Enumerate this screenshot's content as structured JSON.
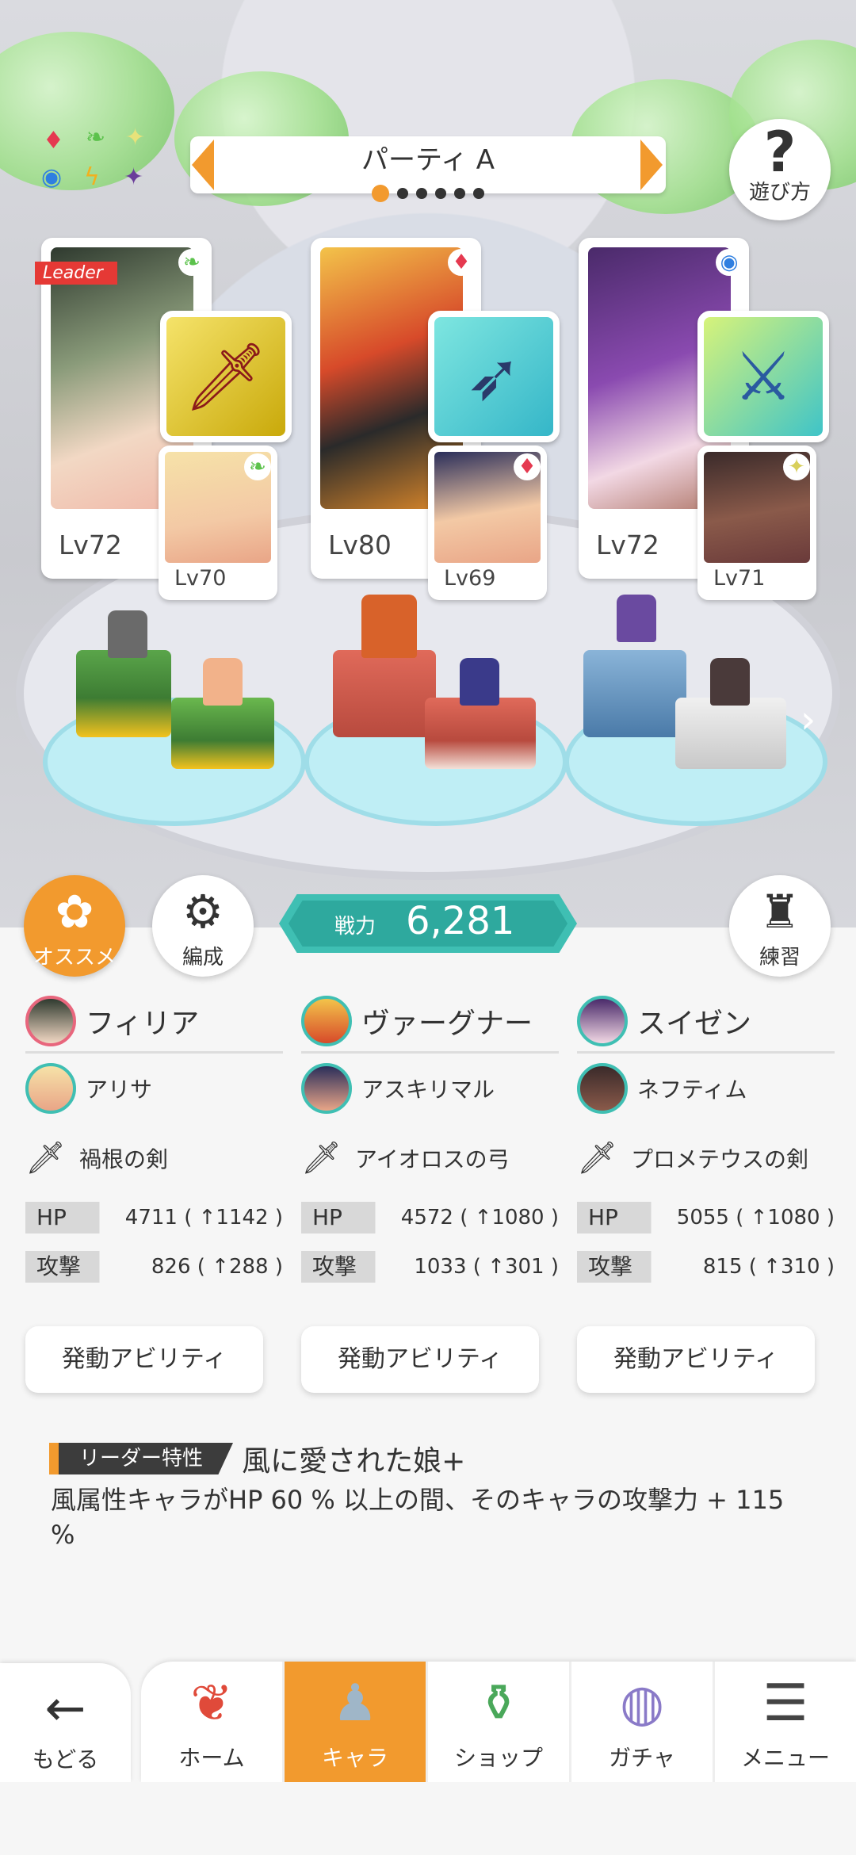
{
  "party": {
    "name": "パーティ A",
    "pages": 6,
    "active_page": 0
  },
  "help": {
    "label": "遊び方"
  },
  "leader_label": "Leader",
  "characters": [
    {
      "main": {
        "name": "フィリア",
        "level": "Lv72",
        "element": "wind"
      },
      "sub": {
        "name": "アリサ",
        "level": "Lv70",
        "element": "wind"
      },
      "weapon": {
        "name": "禍根の剣"
      },
      "hp": {
        "label": "HP",
        "value": "4711 ( ↑1142 )"
      },
      "atk": {
        "label": "攻撃",
        "value": "826 ( ↑288 )"
      },
      "ability_label": "発動アビリティ"
    },
    {
      "main": {
        "name": "ヴァーグナー",
        "level": "Lv80",
        "element": "fire"
      },
      "sub": {
        "name": "アスキリマル",
        "level": "Lv69",
        "element": "fire"
      },
      "weapon": {
        "name": "アイオロスの弓"
      },
      "hp": {
        "label": "HP",
        "value": "4572 ( ↑1080 )"
      },
      "atk": {
        "label": "攻撃",
        "value": "1033 ( ↑301 )"
      },
      "ability_label": "発動アビリティ"
    },
    {
      "main": {
        "name": "スイゼン",
        "level": "Lv72",
        "element": "water"
      },
      "sub": {
        "name": "ネフティム",
        "level": "Lv71",
        "element": "light"
      },
      "weapon": {
        "name": "プロメテウスの剣"
      },
      "hp": {
        "label": "HP",
        "value": "5055 ( ↑1080 )"
      },
      "atk": {
        "label": "攻撃",
        "value": "815 ( ↑310 )"
      },
      "ability_label": "発動アビリティ"
    }
  ],
  "actions": {
    "recommend": "オススメ",
    "formation": "編成",
    "practice": "練習"
  },
  "power": {
    "label": "戦力",
    "value": "6,281"
  },
  "leader_skill": {
    "tag": "リーダー特性",
    "title": "風に愛された娘+",
    "description": "風属性キャラがHP 60 % 以上の間、そのキャラの攻撃力 + 115 %"
  },
  "nav": {
    "back": "もどる",
    "items": [
      {
        "label": "ホーム",
        "icon": "home-icon",
        "active": false
      },
      {
        "label": "キャラ",
        "icon": "character-icon",
        "active": true
      },
      {
        "label": "ショップ",
        "icon": "shop-icon",
        "active": false
      },
      {
        "label": "ガチャ",
        "icon": "gacha-icon",
        "active": false
      },
      {
        "label": "メニュー",
        "icon": "menu-icon",
        "active": false
      }
    ]
  },
  "colors": {
    "accent": "#f29a2e",
    "teal": "#3fbfb3",
    "fire": "#e53950",
    "wind": "#5cc24c",
    "water": "#2f7fe0",
    "light": "#e8e27a"
  }
}
